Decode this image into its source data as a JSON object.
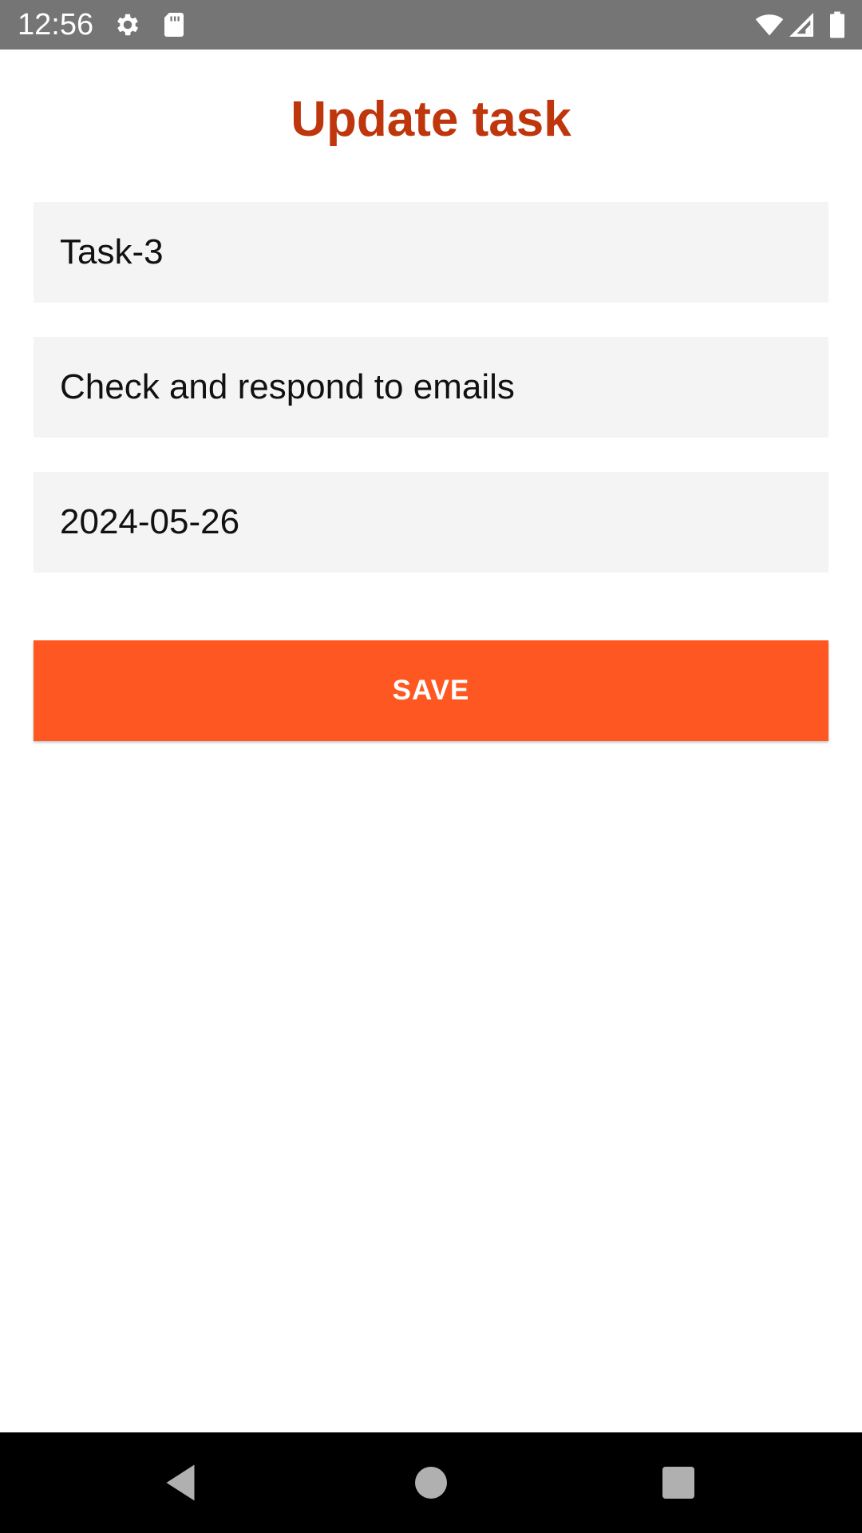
{
  "status_bar": {
    "time": "12:56",
    "icons": [
      "settings-icon",
      "sd-card-icon",
      "wifi-icon",
      "signal-icon",
      "battery-icon"
    ]
  },
  "page": {
    "title": "Update task"
  },
  "form": {
    "name_value": "Task-3",
    "description_value": "Check and respond to emails",
    "date_value": "2024-05-26",
    "save_label": "SAVE"
  },
  "nav_bar": {
    "icons": [
      "back-icon",
      "home-icon",
      "recents-icon"
    ]
  },
  "colors": {
    "status_bar_bg": "#757575",
    "title": "#bf360c",
    "field_bg": "#f4f4f4",
    "button_bg": "#ff5722",
    "button_text": "#ffffff",
    "nav_bar_bg": "#000000"
  }
}
